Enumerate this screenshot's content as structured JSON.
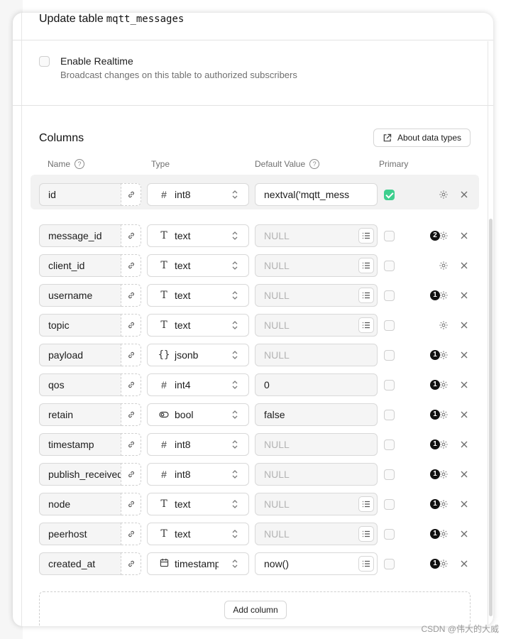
{
  "header": {
    "title": "Update table",
    "table_name": "mqtt_messages"
  },
  "realtime": {
    "checked": false,
    "label": "Enable Realtime",
    "description": "Broadcast changes on this table to authorized subscribers"
  },
  "columns_section": {
    "title": "Columns",
    "about_button": "About data types",
    "headers": {
      "name": "Name",
      "type": "Type",
      "default": "Default Value",
      "primary": "Primary"
    },
    "add_button": "Add column"
  },
  "columns": [
    {
      "name": "id",
      "type_icon": "#",
      "type": "int8",
      "default": "nextval('mqtt_mess",
      "default_is_placeholder": false,
      "default_bg": "white",
      "has_list": false,
      "primary": true,
      "badge": ""
    },
    {
      "name": "message_id",
      "type_icon": "T",
      "type": "text",
      "default": "NULL",
      "default_is_placeholder": true,
      "default_bg": "grey",
      "has_list": true,
      "primary": false,
      "badge": "2"
    },
    {
      "name": "client_id",
      "type_icon": "T",
      "type": "text",
      "default": "NULL",
      "default_is_placeholder": true,
      "default_bg": "grey",
      "has_list": true,
      "primary": false,
      "badge": ""
    },
    {
      "name": "username",
      "type_icon": "T",
      "type": "text",
      "default": "NULL",
      "default_is_placeholder": true,
      "default_bg": "grey",
      "has_list": true,
      "primary": false,
      "badge": "1"
    },
    {
      "name": "topic",
      "type_icon": "T",
      "type": "text",
      "default": "NULL",
      "default_is_placeholder": true,
      "default_bg": "grey",
      "has_list": true,
      "primary": false,
      "badge": ""
    },
    {
      "name": "payload",
      "type_icon": "{}",
      "type": "jsonb",
      "default": "NULL",
      "default_is_placeholder": true,
      "default_bg": "grey",
      "has_list": false,
      "primary": false,
      "badge": "1"
    },
    {
      "name": "qos",
      "type_icon": "#",
      "type": "int4",
      "default": "0",
      "default_is_placeholder": false,
      "default_bg": "grey",
      "has_list": false,
      "primary": false,
      "badge": "1"
    },
    {
      "name": "retain",
      "type_icon": "toggle",
      "type": "bool",
      "default": "false",
      "default_is_placeholder": false,
      "default_bg": "grey",
      "has_list": false,
      "primary": false,
      "badge": "1"
    },
    {
      "name": "timestamp",
      "type_icon": "#",
      "type": "int8",
      "default": "NULL",
      "default_is_placeholder": true,
      "default_bg": "grey",
      "has_list": false,
      "primary": false,
      "badge": "1"
    },
    {
      "name": "publish_received_at",
      "type_icon": "#",
      "type": "int8",
      "default": "NULL",
      "default_is_placeholder": true,
      "default_bg": "grey",
      "has_list": false,
      "primary": false,
      "badge": "1"
    },
    {
      "name": "node",
      "type_icon": "T",
      "type": "text",
      "default": "NULL",
      "default_is_placeholder": true,
      "default_bg": "grey",
      "has_list": true,
      "primary": false,
      "badge": "1"
    },
    {
      "name": "peerhost",
      "type_icon": "T",
      "type": "text",
      "default": "NULL",
      "default_is_placeholder": true,
      "default_bg": "grey",
      "has_list": true,
      "primary": false,
      "badge": "1"
    },
    {
      "name": "created_at",
      "type_icon": "calendar",
      "type": "timestamptz",
      "default": "now()",
      "default_is_placeholder": false,
      "default_bg": "white",
      "has_list": true,
      "primary": false,
      "badge": "1"
    }
  ],
  "colors": {
    "accent_green": "#3ecf8e",
    "badge": "#111111"
  },
  "watermark": "CSDN @伟大的大威"
}
